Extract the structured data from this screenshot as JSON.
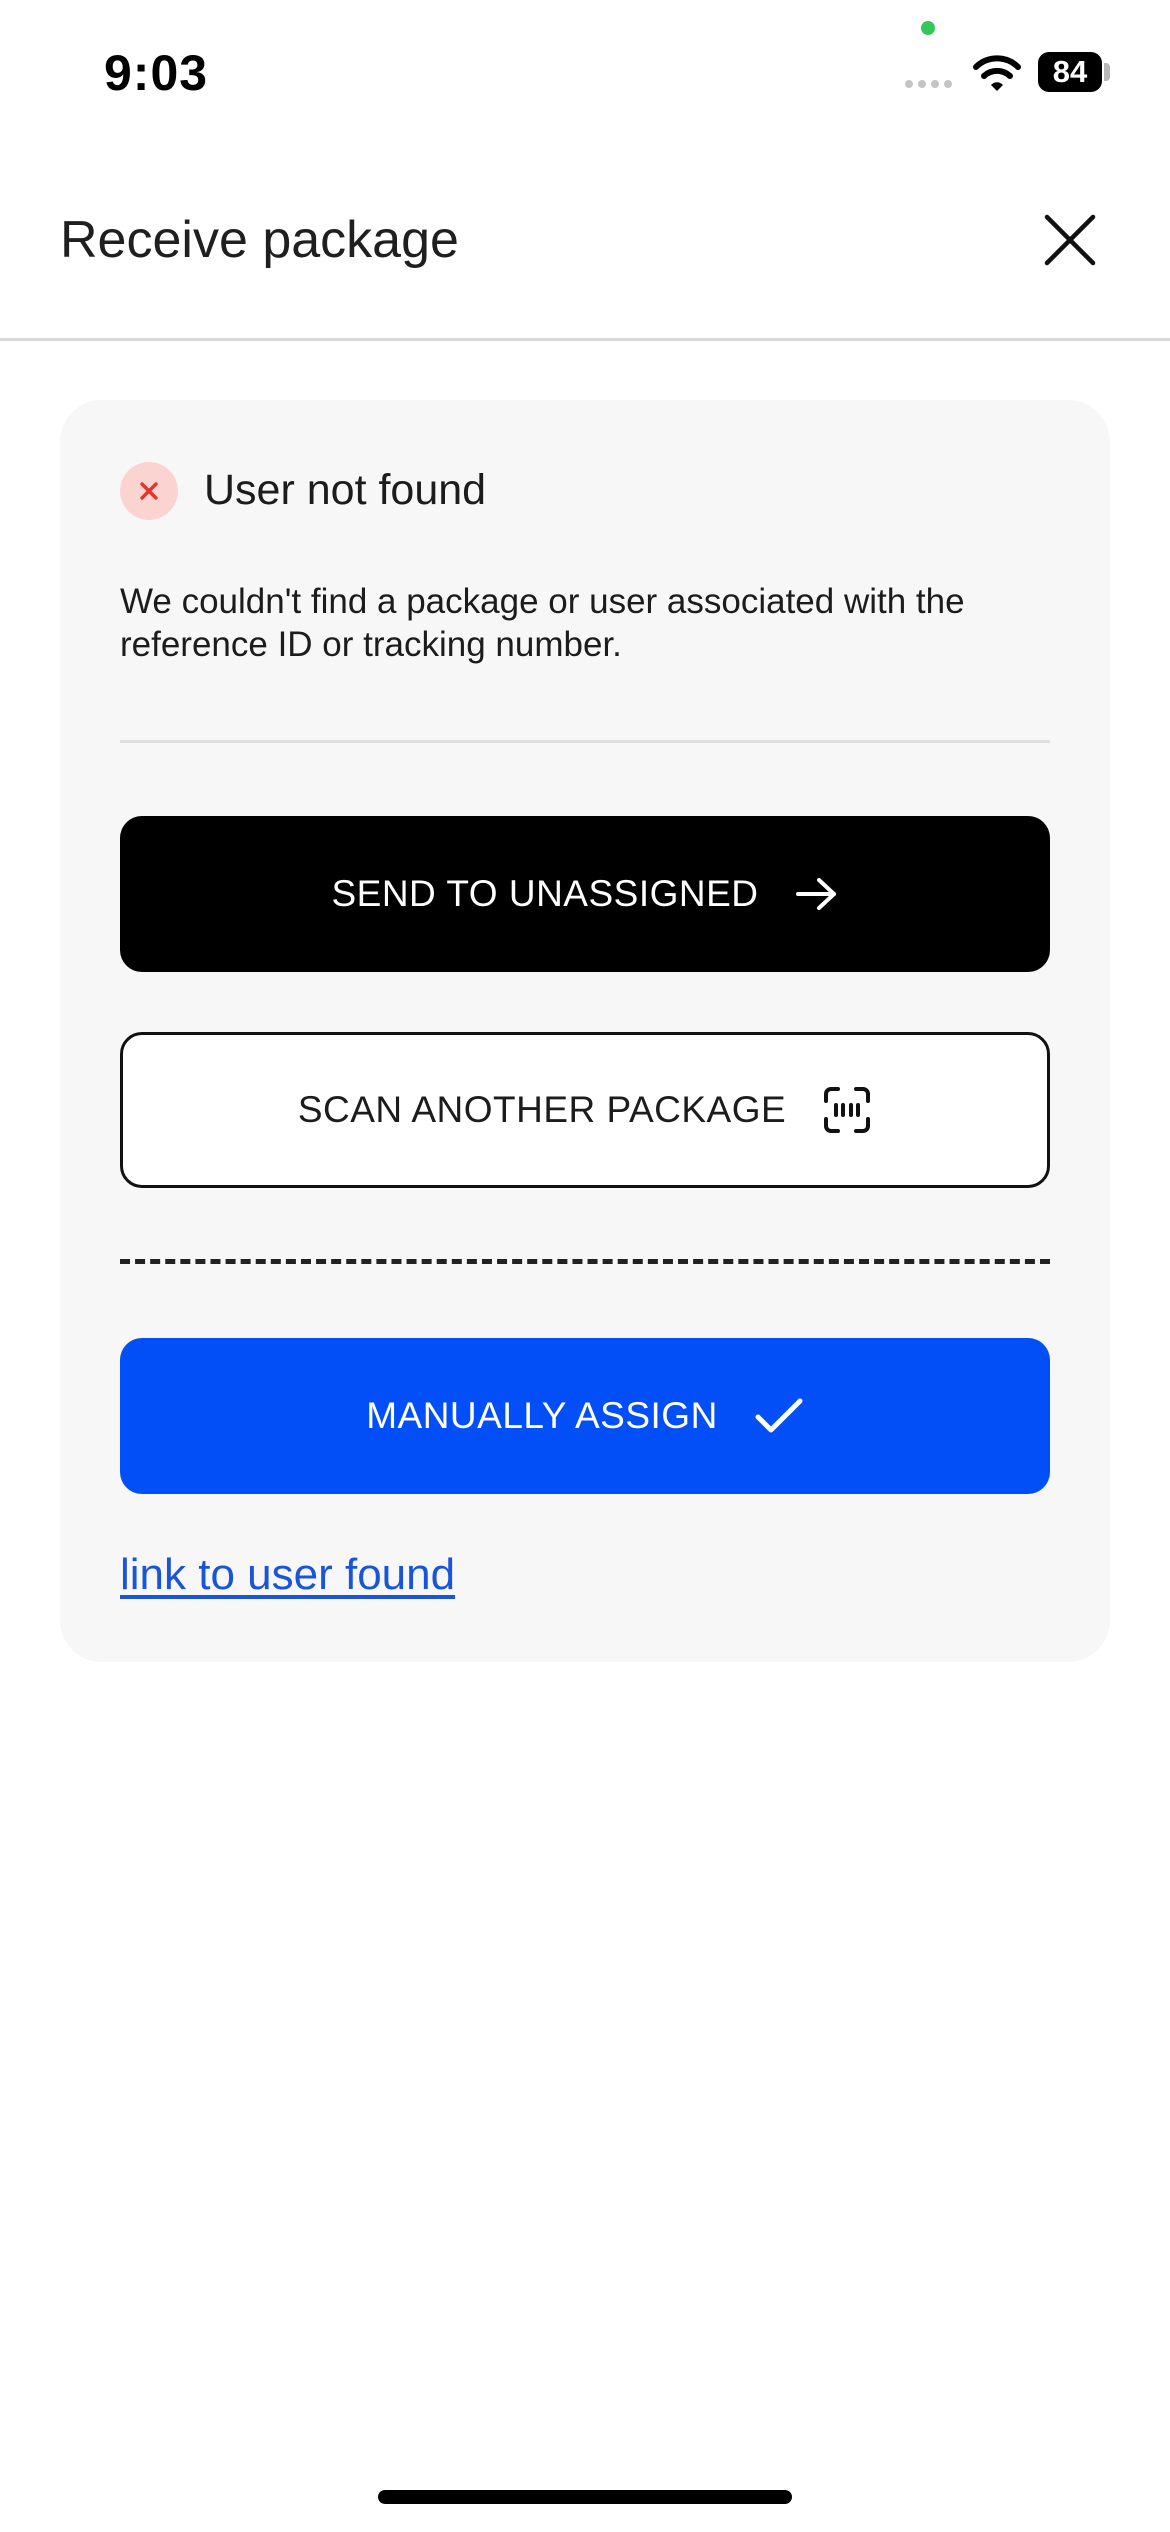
{
  "status_bar": {
    "time": "9:03",
    "battery": "84"
  },
  "header": {
    "title": "Receive package"
  },
  "card": {
    "title": "User not found",
    "message": "We couldn't find a package or user associated with the reference ID or tracking number.",
    "send_label": "SEND TO UNASSIGNED",
    "scan_label": "SCAN ANOTHER PACKAGE",
    "assign_label": "MANUALLY ASSIGN",
    "link_label": "link to user found"
  },
  "colors": {
    "primary_button": "#000000",
    "accent_blue": "#024ff8",
    "error_badge_bg": "#fbd4d2",
    "error_icon": "#e5342c",
    "link": "#1a55d8"
  },
  "icons": {
    "close": "close-icon",
    "error": "error-x-icon",
    "send": "arrow-right-icon",
    "scan": "barcode-scan-icon",
    "assign": "checkmark-icon"
  }
}
